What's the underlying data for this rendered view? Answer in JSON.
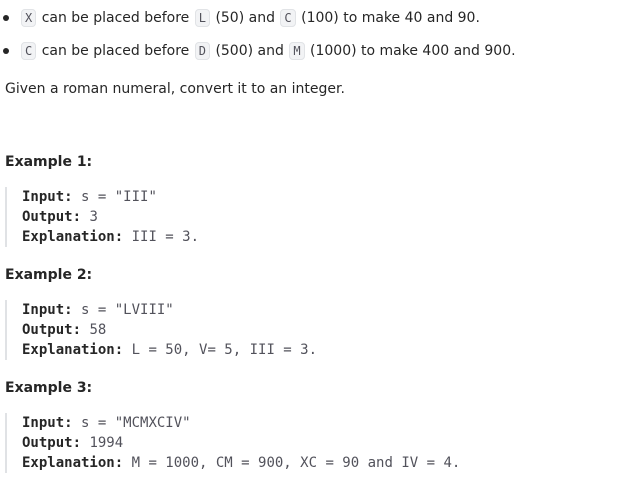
{
  "bullets": [
    {
      "code1": "X",
      "text1": "can be placed before",
      "code2": "L",
      "text2": "(50) and",
      "code3": "C",
      "text3": "(100) to make 40 and 90."
    },
    {
      "code1": "C",
      "text1": "can be placed before",
      "code2": "D",
      "text2": "(500) and",
      "code3": "M",
      "text3": "(1000) to make 400 and 900."
    }
  ],
  "statement": "Given a roman numeral, convert it to an integer.",
  "examples": [
    {
      "title": "Example 1:",
      "input_label": "Input:",
      "input_value": "s = \"III\"",
      "output_label": "Output:",
      "output_value": "3",
      "explanation_label": "Explanation:",
      "explanation_value": "III = 3."
    },
    {
      "title": "Example 2:",
      "input_label": "Input:",
      "input_value": "s = \"LVIII\"",
      "output_label": "Output:",
      "output_value": "58",
      "explanation_label": "Explanation:",
      "explanation_value": "L = 50, V= 5, III = 3."
    },
    {
      "title": "Example 3:",
      "input_label": "Input:",
      "input_value": "s = \"MCMXCIV\"",
      "output_label": "Output:",
      "output_value": "1994",
      "explanation_label": "Explanation:",
      "explanation_value": "M = 1000, CM = 900, XC = 90 and IV = 4."
    }
  ]
}
